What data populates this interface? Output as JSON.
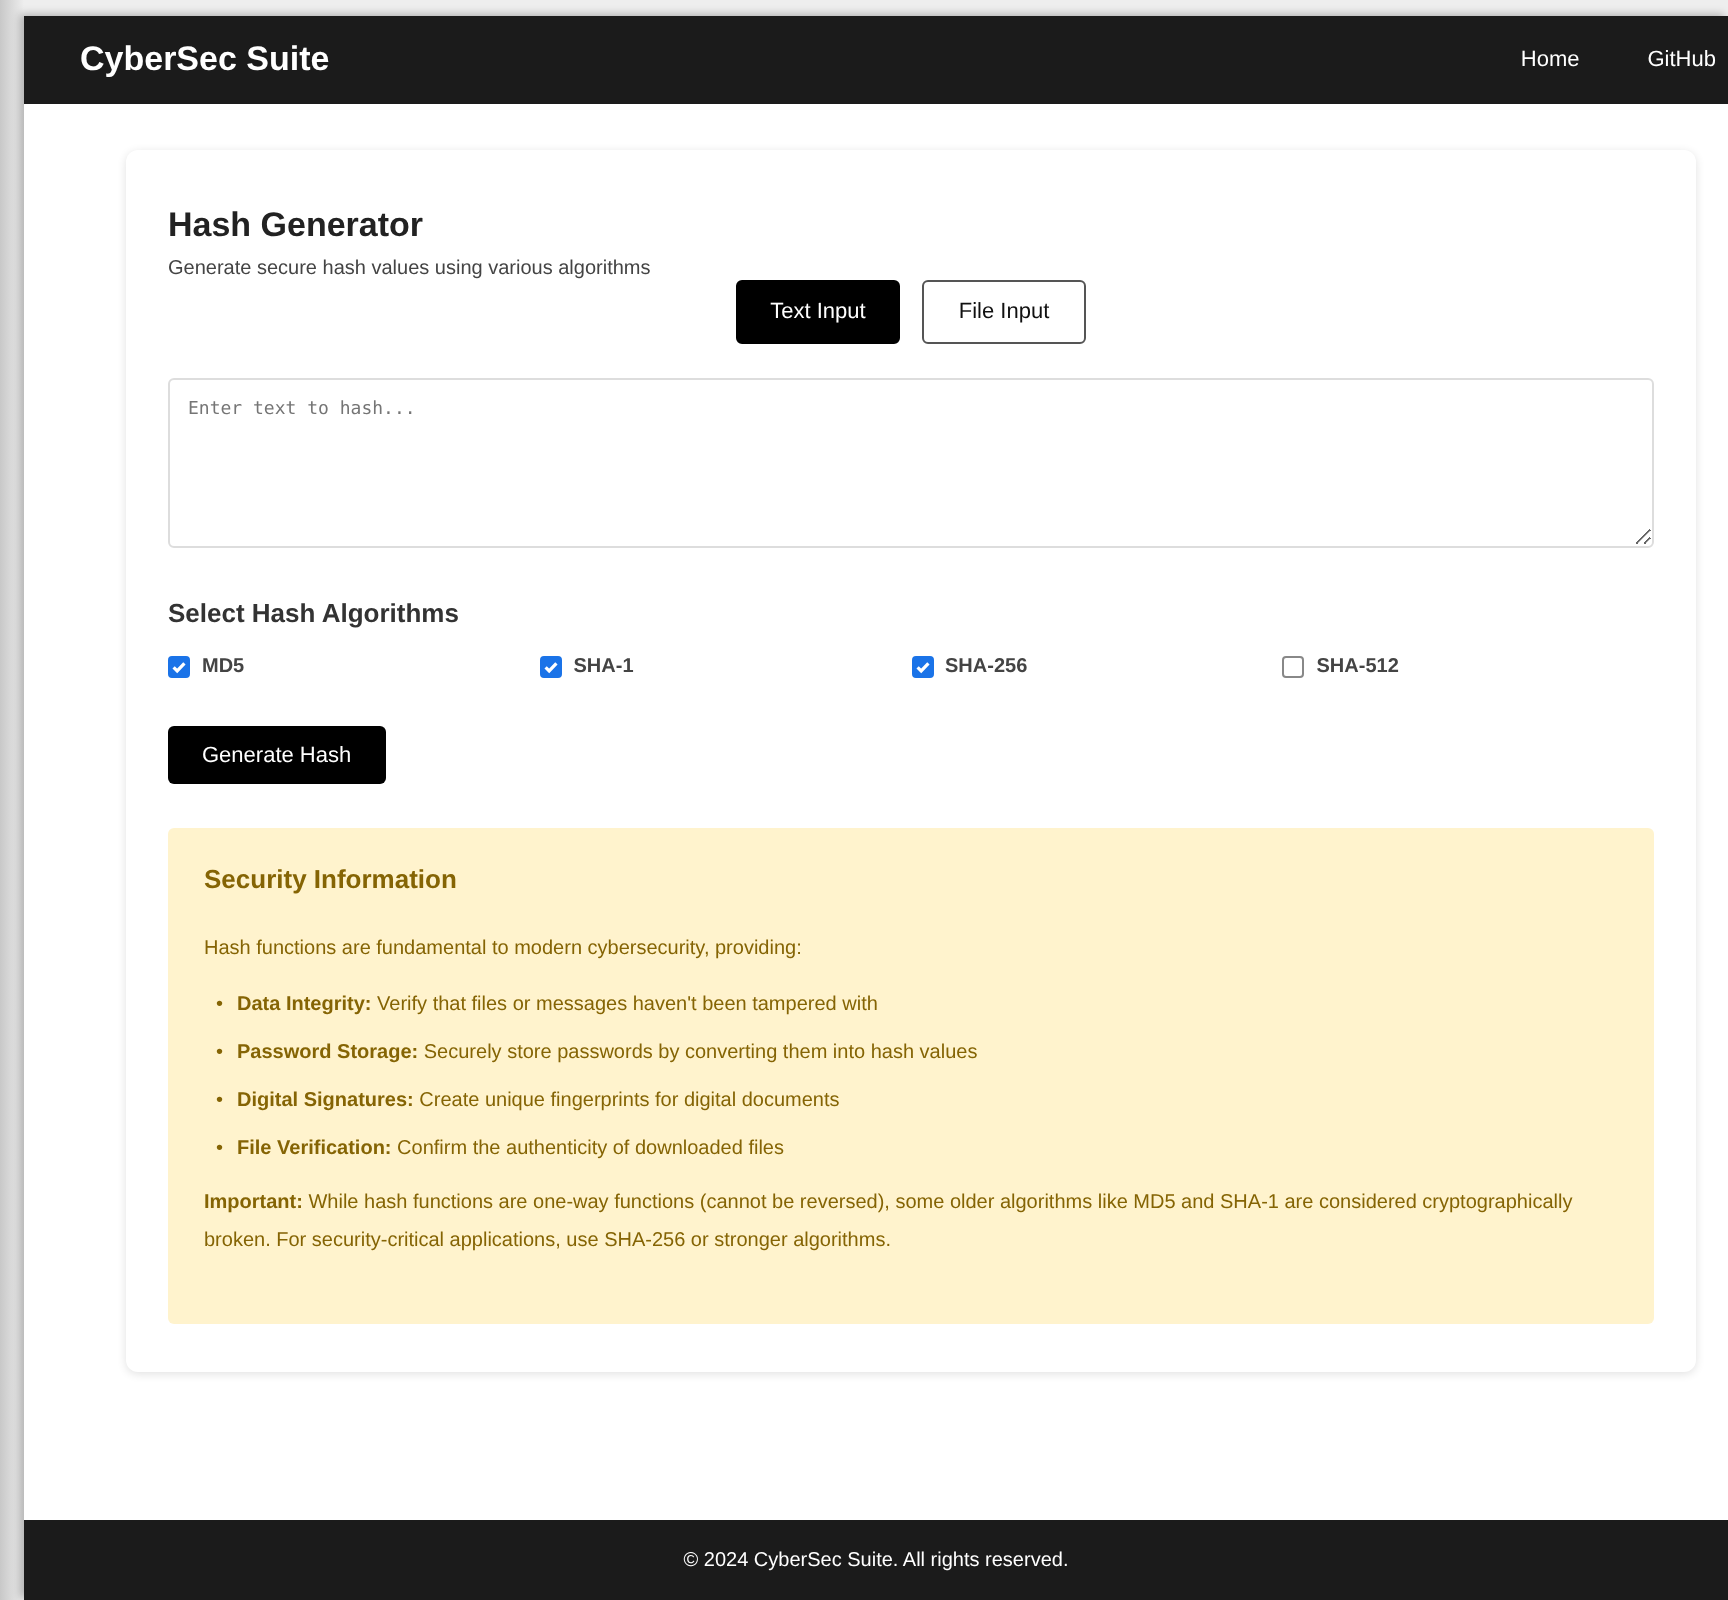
{
  "navbar": {
    "brand": "CyberSec Suite",
    "links": [
      "Home",
      "GitHub"
    ]
  },
  "tool": {
    "title": "Hash Generator",
    "subtitle": "Generate secure hash values using various algorithms",
    "modes": [
      {
        "label": "Text Input",
        "selected": true
      },
      {
        "label": "File Input",
        "selected": false
      }
    ],
    "textarea": {
      "placeholder": "Enter text to hash..."
    },
    "algorithms_title": "Select Hash Algorithms",
    "algorithms": [
      {
        "label": "MD5",
        "checked": true
      },
      {
        "label": "SHA-1",
        "checked": true
      },
      {
        "label": "SHA-256",
        "checked": true
      },
      {
        "label": "SHA-512",
        "checked": false
      }
    ],
    "generate_button": "Generate Hash"
  },
  "info": {
    "title": "Security Information",
    "intro": "Hash functions are fundamental to modern cybersecurity, providing:",
    "bullet": "•",
    "items": [
      "**Data Integrity:** Verify that files or messages haven't been tampered with",
      "**Password Storage:** Securely store passwords by converting them into hash values",
      "**Digital Signatures:** Create unique fingerprints for digital documents",
      "**File Verification:** Confirm the authenticity of downloaded files"
    ],
    "note": "**Important:** While hash functions are one-way functions (cannot be reversed), some older algorithms like MD5 and SHA-1 are considered cryptographically broken. For security-critical applications, use SHA-256 or stronger algorithms."
  },
  "footer": "© 2024 CyberSec Suite. All rights reserved."
}
